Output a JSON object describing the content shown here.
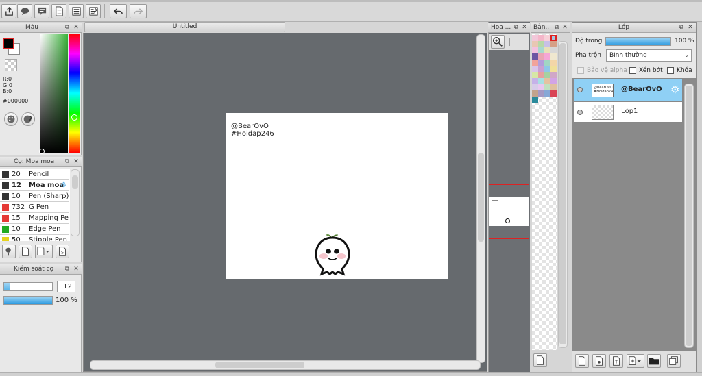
{
  "toolbar": {
    "buttons": [
      "export-icon",
      "speech-bubble-icon",
      "comment-icon",
      "document-icon",
      "list-icon",
      "checklist-icon",
      "undo-icon",
      "redo-icon"
    ]
  },
  "color_panel": {
    "title": "Màu",
    "r": "R:0",
    "g": "G:0",
    "b": "B:0",
    "hex": "#000000",
    "foreground": "#000000",
    "background": "#ffffff"
  },
  "brush_panel": {
    "title": "Cọ: Moa moa",
    "brushes": [
      {
        "size": "20",
        "name": "Pencil",
        "color": "#333333",
        "selected": false
      },
      {
        "size": "12",
        "name": "Moa moa",
        "color": "#333333",
        "selected": true
      },
      {
        "size": "10",
        "name": "Pen (Sharp)",
        "color": "#333333",
        "selected": false
      },
      {
        "size": "732",
        "name": "G Pen",
        "color": "#e53935",
        "selected": false
      },
      {
        "size": "15",
        "name": "Mapping Pen",
        "color": "#e53935",
        "selected": false
      },
      {
        "size": "10",
        "name": "Edge Pen",
        "color": "#22aa22",
        "selected": false
      },
      {
        "size": "50",
        "name": "Stipple Pen",
        "color": "#e6d21e",
        "selected": false
      }
    ]
  },
  "brush_control": {
    "title": "Kiểm soát cọ",
    "size_value": "12",
    "opacity_label": "100 %",
    "size_fraction": 0.12,
    "opacity_fraction": 1.0
  },
  "canvas": {
    "tab_title": "Untitled",
    "text_line1": "@BearOvO",
    "text_line2": "#Hoidap246"
  },
  "navigator": {
    "title": "Hoa ..."
  },
  "palette": {
    "title": "Bản...",
    "colors": [
      "#f2c7d9",
      "#f4b6c9",
      "#f7d0d8",
      "#a6c5e0",
      "#e8c7b3",
      "#b7d8a7",
      "#c8c0e6",
      "#d5a087",
      "#f3c1e0",
      "#a8d8ce",
      "#e8e0b8",
      "#d7d7d7",
      "#6c55a3",
      "#e9a5b4",
      "#f5a6d6",
      "#efe7cf",
      "#f1a39b",
      "#b39ddb",
      "#a0d6c3",
      "#f3d6a8",
      "#d9c5ea",
      "#c9a0d2",
      "#8fc7e8",
      "#f0e09a",
      "#d6e7a6",
      "#e7a0a0",
      "#a6d1a1",
      "#d0a7c7",
      "#c5b2e8",
      "#a7e0e3",
      "#e5c2a1",
      "#d2a3e6",
      "#d7cce9",
      "#e8c8f0",
      "#c0e0c0",
      "#e0c0a0",
      "#c2a38c",
      "#a599c4",
      "#86a8d6",
      "#d94455",
      "#2a8a9b"
    ]
  },
  "layer_panel": {
    "title": "Lớp",
    "opacity_label": "Độ trong",
    "opacity_value": "100 %",
    "opacity_fraction": 1.0,
    "blend_label": "Pha trộn",
    "blend_value": "Bình thường",
    "protect_alpha": "Bảo vệ alpha",
    "clipping": "Xén bớt",
    "lock": "Khóa",
    "layers": [
      {
        "name": "@BearOvO",
        "selected": true
      },
      {
        "name": "Lớp1",
        "selected": false
      }
    ]
  }
}
